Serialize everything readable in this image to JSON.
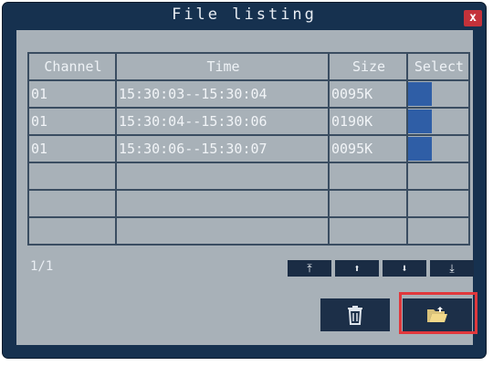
{
  "window": {
    "title": "File listing",
    "close_glyph": "x"
  },
  "table": {
    "headers": [
      "Channel",
      "Time",
      "Size",
      "Select"
    ],
    "rows": [
      {
        "channel": "01",
        "time": "15:30:03--15:30:04",
        "size": "0095K"
      },
      {
        "channel": "01",
        "time": "15:30:04--15:30:06",
        "size": "0190K"
      },
      {
        "channel": "01",
        "time": "15:30:06--15:30:07",
        "size": "0095K"
      },
      {
        "channel": "",
        "time": "",
        "size": ""
      },
      {
        "channel": "",
        "time": "",
        "size": ""
      },
      {
        "channel": "",
        "time": "",
        "size": ""
      }
    ]
  },
  "pagination": {
    "page": "1/1"
  },
  "nav": {
    "first_icon": "first-page-icon",
    "prev_icon": "arrow-up-icon",
    "next_icon": "arrow-down-icon",
    "last_icon": "last-page-icon"
  },
  "actions": {
    "delete_icon": "trash-icon",
    "backup_icon": "folder-open-icon"
  },
  "colors": {
    "window_bg": "#16314f",
    "panel_bg": "#a8b1b8",
    "select_fill": "#2f5ea6",
    "highlight": "#e0383c"
  }
}
